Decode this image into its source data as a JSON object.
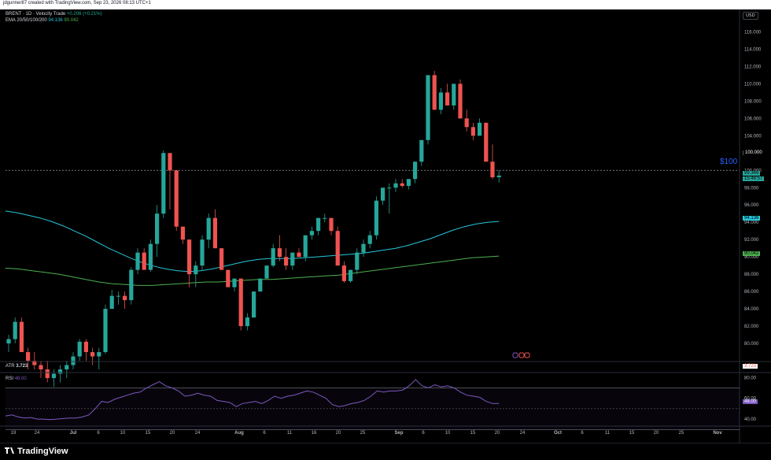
{
  "header": {
    "credit": "jdgunner87 created with TradingView.com, Sep 23, 2026 08:13 UTC+1"
  },
  "legend": {
    "symbol": "BRENT · 1D · Velocity Trade",
    "change": "+0.206 (+0.21%)",
    "ema_label": "EMA 20/50/100/200",
    "ema_val1": "94.136",
    "ema_val2": "90.042",
    "atr_label": "ATR",
    "atr_value": "3.723",
    "rsi_label": "RSI",
    "rsi_value": "48.00"
  },
  "currency_button": "USD",
  "annotation": "$100",
  "price_labels": {
    "last_price": "99.349",
    "countdown": "15:46:57",
    "level_100": "100.000",
    "ema_fast": "94.136",
    "ema_slow": "90.042",
    "atr": "3.723",
    "rsi": "48.00"
  },
  "brand": "TradingView",
  "colors": {
    "up": "#26a69a",
    "down": "#ef5350",
    "ema_fast": "#26c6da",
    "ema_slow": "#4caf50",
    "rsi": "#7e57c2",
    "accent": "#2962ff"
  },
  "chart_data": [
    {
      "type": "candlestick",
      "title": "BRENT · 1D · Velocity Trade",
      "y_axis_ticks": [
        "80.000",
        "82.000",
        "84.000",
        "86.000",
        "88.000",
        "90.000",
        "92.000",
        "94.000",
        "96.000",
        "98.000",
        "100.000",
        "102.000",
        "104.000",
        "106.000",
        "108.000",
        "110.000",
        "112.000",
        "114.000",
        "116.000"
      ],
      "ylim": [
        78,
        117.5
      ],
      "x_axis_ticks": [
        "19",
        "24",
        "Jul",
        "6",
        "10",
        "15",
        "20",
        "24",
        "Aug",
        "6",
        "11",
        "16",
        "20",
        "25",
        "Sep",
        "6",
        "10",
        "15",
        "20",
        "24",
        "Oct",
        "6",
        "11",
        "15",
        "20",
        "25",
        "Nov"
      ],
      "candles": [
        [
          80,
          81,
          79,
          80.5
        ],
        [
          80.5,
          83,
          80,
          82.5
        ],
        [
          82.5,
          83,
          80,
          79
        ],
        [
          79,
          79.5,
          77,
          78
        ],
        [
          78,
          79,
          77,
          77.5
        ],
        [
          77.5,
          78,
          76,
          77
        ],
        [
          77,
          78,
          75.5,
          76
        ],
        [
          76,
          77,
          75,
          76.5
        ],
        [
          76.5,
          77.5,
          75.5,
          77
        ],
        [
          77,
          78,
          76,
          77.5
        ],
        [
          77.5,
          79,
          77,
          78.5
        ],
        [
          78.5,
          80.5,
          78,
          80.2
        ],
        [
          80.2,
          80.5,
          78,
          79
        ],
        [
          79,
          79.5,
          77.5,
          78.5
        ],
        [
          78.5,
          79.5,
          77,
          79
        ],
        [
          79,
          84.5,
          78.8,
          84
        ],
        [
          84,
          86.2,
          84.2,
          85.5
        ],
        [
          85.5,
          86,
          84.5,
          85.5
        ],
        [
          85.5,
          86,
          84,
          85
        ],
        [
          85,
          88.8,
          84.5,
          88.5
        ],
        [
          88.5,
          91,
          88,
          90.5
        ],
        [
          90.5,
          91,
          88.5,
          88.5
        ],
        [
          88.5,
          92,
          88.3,
          91.5
        ],
        [
          91.5,
          96,
          90,
          95
        ],
        [
          95,
          102.3,
          94.5,
          102
        ],
        [
          102,
          102,
          95.5,
          100
        ],
        [
          100,
          97,
          93,
          93.5
        ],
        [
          93.5,
          93.5,
          91.5,
          92
        ],
        [
          92,
          92,
          86.5,
          88
        ],
        [
          88,
          89.5,
          86.5,
          89
        ],
        [
          89,
          92.5,
          88.5,
          92
        ],
        [
          92,
          95,
          91,
          94.5
        ],
        [
          94.5,
          95.5,
          91.5,
          91
        ],
        [
          91,
          90.5,
          88.5,
          88.5
        ],
        [
          88.5,
          88.5,
          86.5,
          86.5
        ],
        [
          86.5,
          87,
          86,
          87.5
        ],
        [
          87.5,
          87,
          81.5,
          82
        ],
        [
          82,
          83.5,
          81.5,
          83
        ],
        [
          83,
          83.5,
          84.5,
          86
        ],
        [
          86,
          86.5,
          87.5,
          87.5
        ],
        [
          87.5,
          88,
          89.5,
          89
        ],
        [
          89,
          91.5,
          88.8,
          91
        ],
        [
          91,
          92.5,
          89.5,
          90
        ],
        [
          90,
          91,
          88.5,
          89
        ],
        [
          89,
          90.5,
          88.5,
          90.5
        ],
        [
          90.5,
          91,
          90,
          90
        ],
        [
          90,
          92.5,
          89.5,
          92.5
        ],
        [
          92.5,
          93.5,
          92,
          93
        ],
        [
          93,
          94.5,
          92.5,
          94.5
        ],
        [
          94.5,
          95,
          94,
          94.5
        ],
        [
          94.5,
          94.5,
          92.5,
          93
        ],
        [
          93,
          93.5,
          89,
          89
        ],
        [
          89,
          89.5,
          87,
          87.2
        ],
        [
          87.2,
          88.5,
          87,
          88.5
        ],
        [
          88.5,
          91,
          88,
          90.5
        ],
        [
          90.5,
          92,
          90,
          91.5
        ],
        [
          91.5,
          93,
          91,
          92.5
        ],
        [
          92.5,
          97,
          92,
          96.5
        ],
        [
          96.5,
          98,
          96,
          98
        ],
        [
          98,
          98.5,
          95,
          98
        ],
        [
          98,
          99,
          97.5,
          98.5
        ],
        [
          98.5,
          99,
          98,
          98.2
        ],
        [
          98.2,
          99,
          97.8,
          99
        ],
        [
          99,
          101,
          98.5,
          101
        ],
        [
          101,
          103.5,
          100.5,
          103.5
        ],
        [
          103.5,
          111,
          103,
          111
        ],
        [
          111,
          111.5,
          108,
          107
        ],
        [
          107,
          109.5,
          106.5,
          109
        ],
        [
          109,
          110,
          107.5,
          107.5
        ],
        [
          107.5,
          110,
          107,
          110
        ],
        [
          110,
          110.5,
          106,
          106
        ],
        [
          106,
          107,
          104.5,
          105
        ],
        [
          105,
          105.5,
          103.5,
          104
        ],
        [
          104,
          106,
          104,
          105.5
        ],
        [
          105.5,
          105.5,
          101,
          101
        ],
        [
          101,
          103,
          99,
          99.2
        ],
        [
          99.2,
          100,
          98.6,
          99.4
        ]
      ],
      "ema_fast": [
        95.3,
        95.1,
        94.8,
        94.5,
        94.1,
        93.6,
        93.0,
        92.4,
        91.7,
        91.0,
        90.4,
        89.8,
        89.3,
        88.9,
        88.6,
        88.4,
        88.3,
        88.4,
        88.6,
        88.9,
        89.2,
        89.5,
        89.7,
        89.8,
        89.8,
        89.8,
        89.9,
        90.0,
        90.1,
        90.2,
        90.3,
        90.4,
        90.6,
        90.8,
        91.0,
        91.3,
        91.7,
        92.1,
        92.6,
        93.1,
        93.5,
        93.8,
        94.0,
        94.1
      ],
      "ema_slow": [
        88.7,
        88.6,
        88.4,
        88.2,
        88.0,
        87.7,
        87.4,
        87.1,
        86.9,
        86.8,
        86.7,
        86.7,
        86.8,
        86.9,
        87.0,
        87.1,
        87.1,
        87.2,
        87.3,
        87.4,
        87.4,
        87.5,
        87.6,
        87.7,
        87.8,
        87.9,
        88.1,
        88.3,
        88.5,
        88.7,
        88.9,
        89.1,
        89.3,
        89.5,
        89.7,
        89.9,
        90.0,
        90.1
      ],
      "reference_line": 100
    },
    {
      "type": "line",
      "title": "RSI",
      "ylim": [
        34,
        84
      ],
      "y_axis_ticks": [
        "40.00",
        "60.00",
        "80.00"
      ],
      "series": [
        {
          "values": [
            43,
            44,
            42,
            41,
            41.5,
            40,
            40,
            39.5,
            40,
            40.5,
            41,
            41,
            42,
            44,
            50,
            57,
            56,
            59,
            61,
            63,
            65,
            66,
            70,
            73,
            76,
            72,
            70,
            67,
            62,
            63,
            65,
            63,
            62,
            58,
            57,
            56,
            52,
            55,
            56,
            57,
            55,
            58,
            62,
            60,
            62,
            63,
            65,
            67,
            66,
            63,
            60,
            54,
            52,
            53,
            55,
            56,
            58,
            62,
            67,
            66,
            67,
            67,
            68,
            72,
            78,
            72,
            70,
            73,
            71,
            72,
            70,
            66,
            63,
            62,
            61,
            57,
            55,
            55
          ]
        }
      ]
    }
  ]
}
